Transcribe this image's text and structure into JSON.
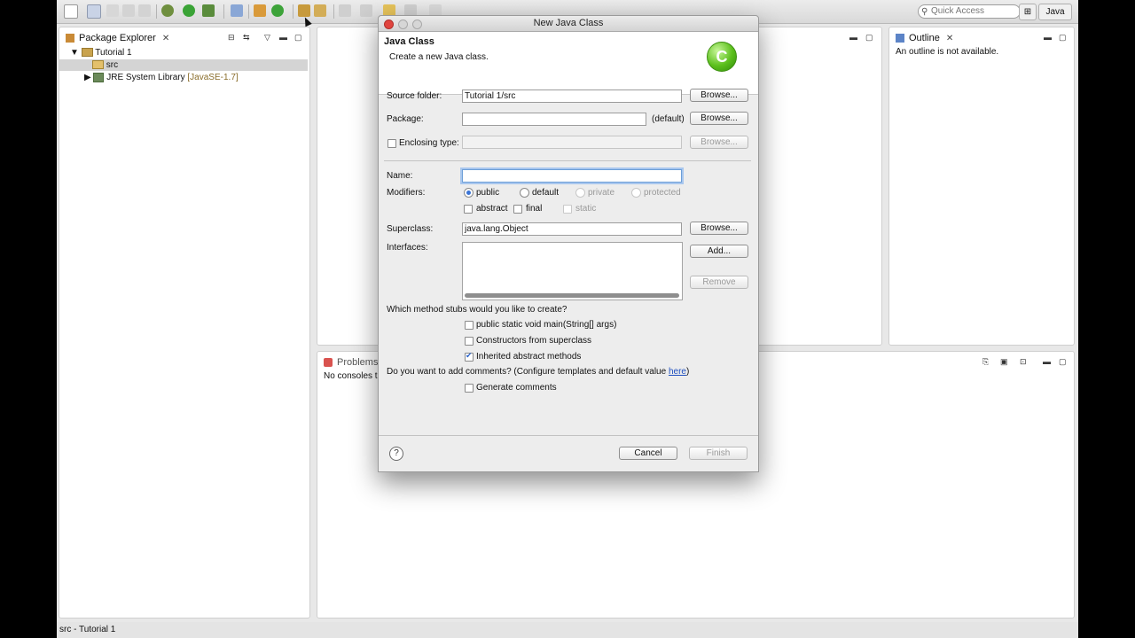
{
  "toolbar": {
    "quick_access_placeholder": "Quick Access",
    "perspective_label": "Java"
  },
  "package_explorer": {
    "tab_label": "Package Explorer",
    "tree": [
      {
        "label": "Tutorial 1"
      },
      {
        "label": "src"
      },
      {
        "label": "JRE System Library",
        "suffix": "[JavaSE-1.7]"
      }
    ]
  },
  "outline": {
    "tab_label": "Outline",
    "message": "An outline is not available."
  },
  "problems": {
    "tab_label": "Problems",
    "console_text": "No consoles to"
  },
  "status_bar": {
    "text": "src - Tutorial 1"
  },
  "dialog": {
    "window_title": "New Java Class",
    "header_title": "Java Class",
    "header_desc": "Create a new Java class.",
    "source_folder": {
      "label": "Source folder:",
      "value": "Tutorial 1/src"
    },
    "package": {
      "label": "Package:",
      "value": "",
      "default_label": "(default)"
    },
    "enclosing_type": {
      "label": "Enclosing type:",
      "value": "",
      "checked": false
    },
    "name": {
      "label": "Name:",
      "value": ""
    },
    "modifiers": {
      "label": "Modifiers:",
      "access": [
        {
          "label": "public",
          "selected": true,
          "enabled": true
        },
        {
          "label": "default",
          "selected": false,
          "enabled": true
        },
        {
          "label": "private",
          "selected": false,
          "enabled": false
        },
        {
          "label": "protected",
          "selected": false,
          "enabled": false
        }
      ],
      "flags": [
        {
          "label": "abstract",
          "checked": false,
          "enabled": true
        },
        {
          "label": "final",
          "checked": false,
          "enabled": true
        },
        {
          "label": "static",
          "checked": false,
          "enabled": false
        }
      ]
    },
    "superclass": {
      "label": "Superclass:",
      "value": "java.lang.Object"
    },
    "interfaces": {
      "label": "Interfaces:"
    },
    "buttons": {
      "browse": "Browse...",
      "add": "Add...",
      "remove": "Remove",
      "cancel": "Cancel",
      "finish": "Finish"
    },
    "stubs": {
      "question": "Which method stubs would you like to create?",
      "options": [
        {
          "label": "public static void main(String[] args)",
          "checked": false
        },
        {
          "label": "Constructors from superclass",
          "checked": false
        },
        {
          "label": "Inherited abstract methods",
          "checked": true
        }
      ]
    },
    "comments": {
      "question_prefix": "Do you want to add comments? (Configure templates and default value ",
      "link": "here",
      "question_suffix": ")",
      "option": {
        "label": "Generate comments",
        "checked": false
      }
    }
  }
}
